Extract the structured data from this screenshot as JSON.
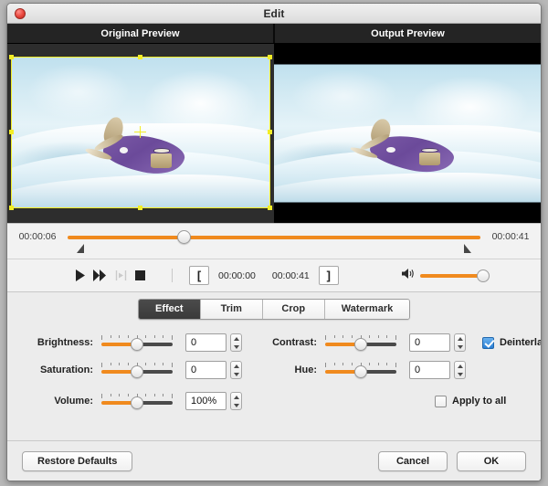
{
  "window": {
    "title": "Edit",
    "close_label": "close"
  },
  "preview": {
    "original_label": "Original Preview",
    "output_label": "Output Preview"
  },
  "timeline": {
    "start_time": "00:00:06",
    "end_time": "00:00:41",
    "playhead_percent": 28
  },
  "transport": {
    "play_icon": "play-icon",
    "forward_icon": "fast-forward-icon",
    "step_icon": "step-frame-icon",
    "stop_icon": "stop-icon",
    "trim_in_bracket": "[",
    "trim_out_bracket": "]",
    "trim_in_time": "00:00:00",
    "trim_out_time": "00:00:41",
    "volume_icon": "speaker-icon",
    "volume_percent": 100
  },
  "tabs": [
    {
      "label": "Effect",
      "active": true
    },
    {
      "label": "Trim",
      "active": false
    },
    {
      "label": "Crop",
      "active": false
    },
    {
      "label": "Watermark",
      "active": false
    }
  ],
  "effects": {
    "brightness": {
      "label": "Brightness:",
      "value": "0"
    },
    "contrast": {
      "label": "Contrast:",
      "value": "0"
    },
    "saturation": {
      "label": "Saturation:",
      "value": "0"
    },
    "hue": {
      "label": "Hue:",
      "value": "0"
    },
    "volume": {
      "label": "Volume:",
      "value": "100%"
    },
    "deinterlacing": {
      "label": "Deinterlacing",
      "checked": true
    },
    "apply_to_all": {
      "label": "Apply to all",
      "checked": false
    }
  },
  "footer": {
    "restore_label": "Restore Defaults",
    "cancel_label": "Cancel",
    "ok_label": "OK"
  },
  "colors": {
    "accent_orange": "#f08a1e",
    "selection_yellow": "#f2ed26",
    "checkbox_blue": "#2a7fd4",
    "tab_active_bg": "#3f3f3f"
  }
}
